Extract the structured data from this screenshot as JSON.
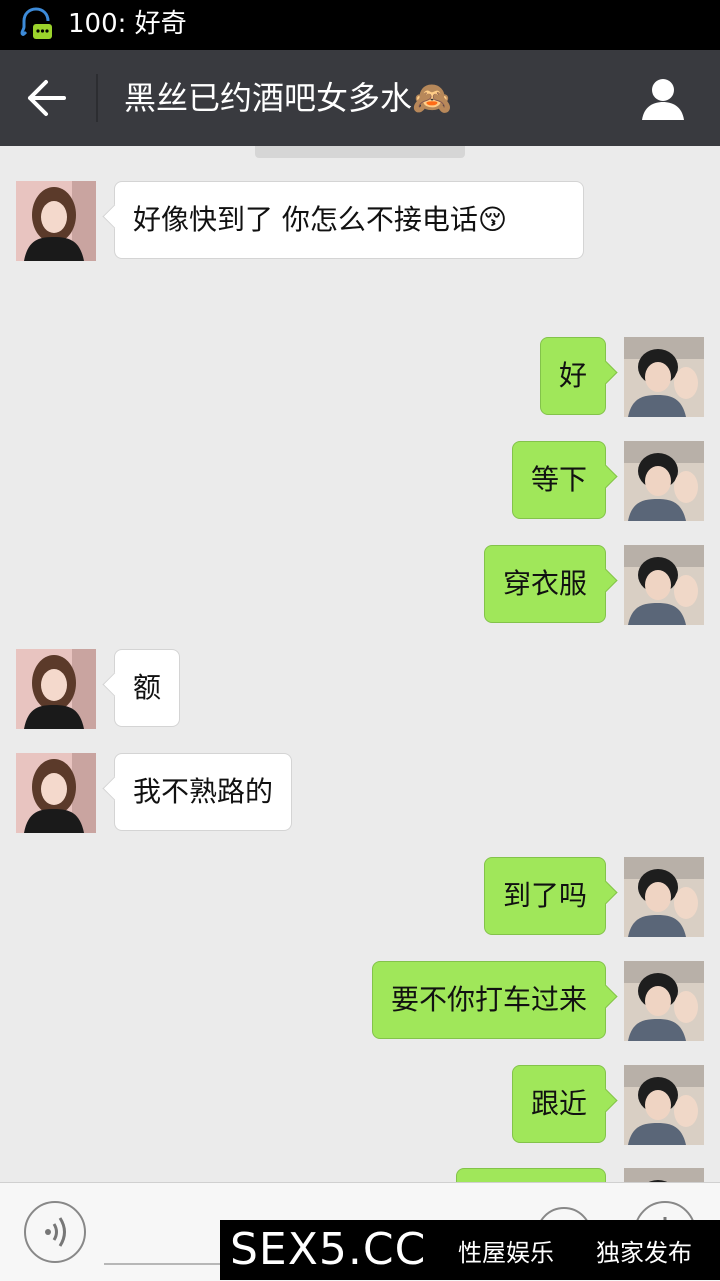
{
  "status_bar": {
    "notification_text": "100: 好奇",
    "icon": "qq-chat-icon"
  },
  "header": {
    "title": "黑丝已约酒吧女多水🙈",
    "back_icon": "back-arrow-icon",
    "profile_icon": "person-icon"
  },
  "messages": [
    {
      "side": "left",
      "text": "好像快到了  你怎么不接电话😚"
    },
    {
      "side": "right",
      "text": "好"
    },
    {
      "side": "right",
      "text": "等下"
    },
    {
      "side": "right",
      "text": "穿衣服"
    },
    {
      "side": "left",
      "text": "额"
    },
    {
      "side": "left",
      "text": "我不熟路的"
    },
    {
      "side": "right",
      "text": "到了吗"
    },
    {
      "side": "right",
      "text": "要不你打车过来"
    },
    {
      "side": "right",
      "text": "跟近"
    }
  ],
  "input_bar": {
    "voice_icon": "voice-icon",
    "emoji_icon": "emoji-icon",
    "plus_icon": "plus-icon"
  },
  "watermark": {
    "logo": "SEX5.CC",
    "text1": "性屋娱乐",
    "text2": "独家发布"
  },
  "colors": {
    "title_bar": "#393a3f",
    "sent_bubble": "#a0e75a",
    "received_bubble": "#ffffff",
    "chat_bg": "#ebebeb"
  }
}
